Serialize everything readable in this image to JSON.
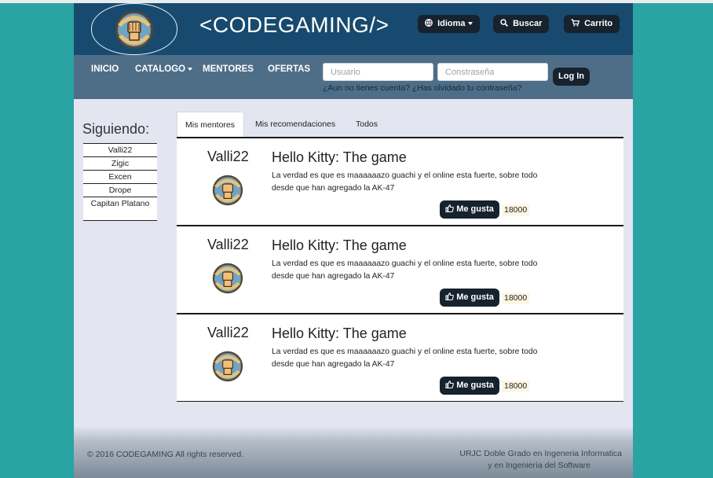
{
  "header": {
    "brand": "<CODEGAMING/>",
    "idioma": "Idioma",
    "buscar": "Buscar",
    "carrito": "Carrito"
  },
  "nav": {
    "items": [
      "INICIO",
      "CATALOGO",
      "MENTORES",
      "OFERTAS"
    ],
    "usuario_placeholder": "Usuario",
    "password_placeholder": "Constraseña",
    "login": "Log In",
    "no_account": "¿Aun no tienes cuenta?",
    "forgot": "¿Has olvidado tu contraseña?"
  },
  "sidebar": {
    "title": "Siguiendo:",
    "following": [
      "Valli22",
      "Zigic",
      "Excen",
      "Drope",
      "Capitan Platano"
    ]
  },
  "tabs": [
    "Mis mentores",
    "Mis recomendaciones",
    "Todos"
  ],
  "posts": [
    {
      "author": "Valli22",
      "title": "Hello Kitty: The game",
      "text": "La verdad es que es maaaaaazo guachi y el online esta fuerte, sobre todo desde que han agregado la AK-47",
      "like_label": "Me gusta",
      "likes": "18000"
    },
    {
      "author": "Valli22",
      "title": "Hello Kitty: The game",
      "text": "La verdad es que es maaaaaazo guachi y el online esta fuerte, sobre todo desde que han agregado la AK-47",
      "like_label": "Me gusta",
      "likes": "18000"
    },
    {
      "author": "Valli22",
      "title": "Hello Kitty: The game",
      "text": "La verdad es que es maaaaaazo guachi y el online esta fuerte, sobre todo desde que han agregado la AK-47",
      "like_label": "Me gusta",
      "likes": "18000"
    }
  ],
  "footer": {
    "copyright": "© 2016 CODEGAMING All rights reserved.",
    "university_line1": "URJC Doble Grado en Ingeneria Informatica",
    "university_line2": "y en Ingeniería del Software"
  },
  "icons": {
    "globe": "globe-icon",
    "search": "search-icon",
    "cart": "cart-icon",
    "thumb": "thumbs-up-icon"
  },
  "colors": {
    "header": "#174a6e",
    "nav": "#4e6e88",
    "button": "#16222e",
    "page_bg": "#e3e5f1",
    "body_bg": "#2aa3a3"
  }
}
